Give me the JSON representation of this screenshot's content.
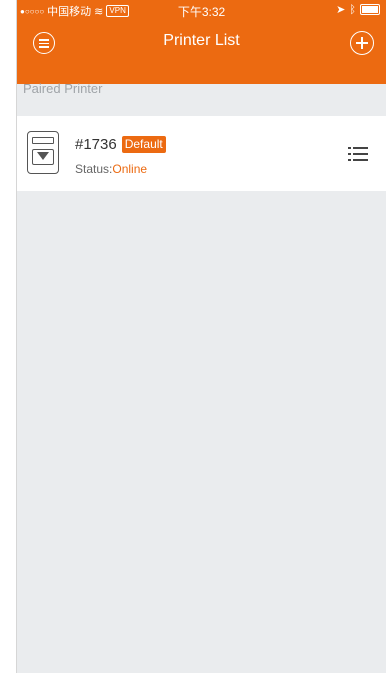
{
  "status_bar": {
    "carrier": "中国移动",
    "vpn": "VPN",
    "time": "下午3:32"
  },
  "nav": {
    "title": "Printer List",
    "left_icon": "menu-circle-icon",
    "right_icon": "add-circle-icon"
  },
  "section": {
    "label": "Paired Printer"
  },
  "printers": [
    {
      "name": "#1736",
      "badge": "Default",
      "status_label": "Status:",
      "status_value": "Online"
    }
  ],
  "colors": {
    "accent": "#ec6a11",
    "background": "#eaecee"
  }
}
